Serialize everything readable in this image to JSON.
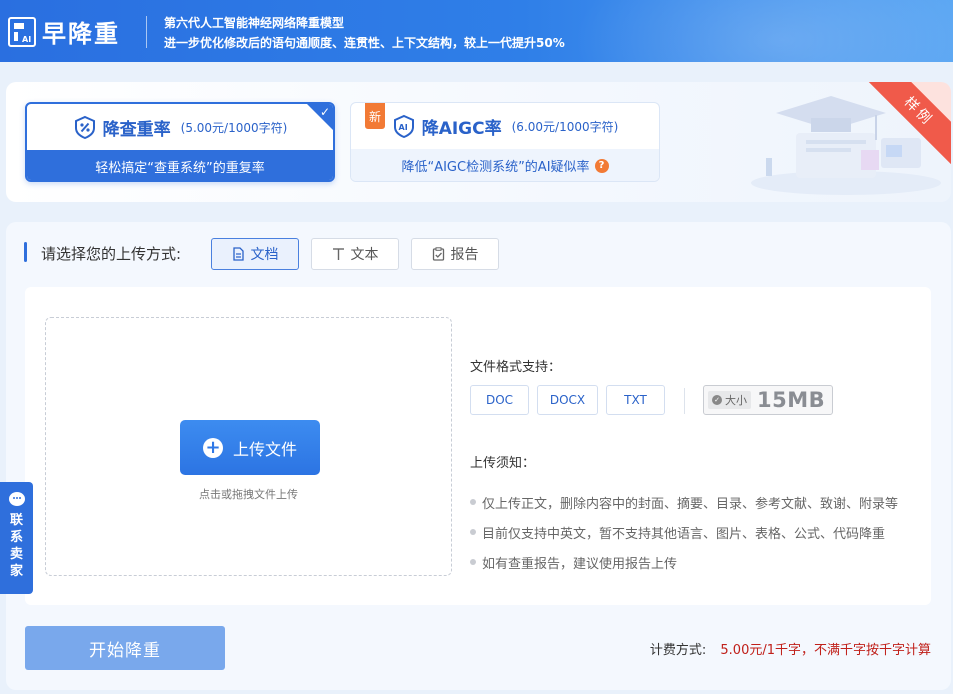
{
  "header": {
    "logo_text": "早降重",
    "slogan_line1": "第六代人工智能神经网络降重模型",
    "slogan_line2": "进一步优化修改后的语句通顺度、连贯性、上下文结构，较上一代提升50%"
  },
  "modes": [
    {
      "title": "降查重率",
      "price": "(5.00元/1000字符)",
      "desc": "轻松搞定“查重系统”的重复率",
      "selected": true,
      "icon": "percent-shield-icon"
    },
    {
      "title": "降AIGC率",
      "price": "(6.00元/1000字符)",
      "desc": "降低“AIGC检测系统”的AI疑似率",
      "badge": "新",
      "selected": false,
      "icon": "ai-shield-icon"
    }
  ],
  "sample_ribbon": "样例",
  "upload": {
    "label": "请选择您的上传方式:",
    "tabs": [
      {
        "label": "文档",
        "icon": "document-icon",
        "active": true
      },
      {
        "label": "文本",
        "icon": "text-icon",
        "active": false
      },
      {
        "label": "报告",
        "icon": "report-icon",
        "active": false
      }
    ],
    "upload_button": "上传文件",
    "drop_hint": "点击或拖拽文件上传",
    "format_label": "文件格式支持：",
    "formats": [
      "DOC",
      "DOCX",
      "TXT"
    ],
    "size_tag": "大小",
    "size_value": "15MB",
    "notice_label": "上传须知：",
    "notices": [
      "仅上传正文，删除内容中的封面、摘要、目录、参考文献、致谢、附录等",
      "目前仅支持中英文，暂不支持其他语言、图片、表格、公式、代码降重",
      "如有查重报告，建议使用报告上传"
    ]
  },
  "start_button": "开始降重",
  "billing": {
    "label": "计费方式:",
    "value": "5.00元/1千字，不满千字按千字计算"
  },
  "side_tab": {
    "label": "联系卖家"
  },
  "colors": {
    "primary": "#2f6fdc",
    "accent_orange": "#f27a35",
    "price_red": "#c0201a",
    "ribbon": "#f05a4a"
  }
}
